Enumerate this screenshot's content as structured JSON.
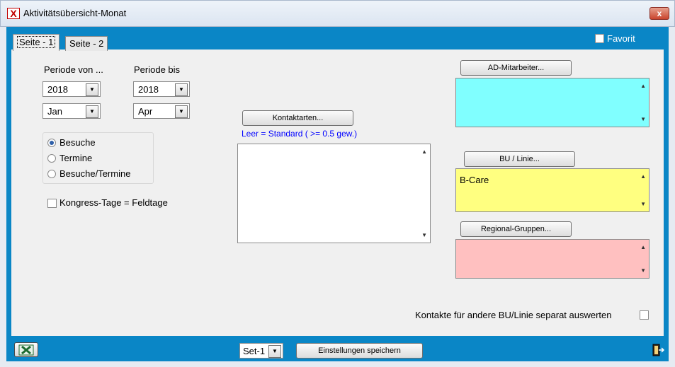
{
  "window": {
    "title": "Aktivitätsübersicht-Monat",
    "close_label": "x"
  },
  "tabs": [
    {
      "label": "Seite - 1"
    },
    {
      "label": "Seite - 2"
    }
  ],
  "favorite_label": "Favorit",
  "period": {
    "from_label": "Periode von ...",
    "to_label": "Periode bis",
    "from_year": "2018",
    "from_month": "Jan",
    "to_year": "2018",
    "to_month": "Apr"
  },
  "radio_options": [
    "Besuche",
    "Termine",
    "Besuche/Termine"
  ],
  "congress_label": "Kongress-Tage = Feldtage",
  "contact_types": {
    "button_label": "Kontaktarten...",
    "hint": "Leer = Standard  ( >= 0.5 gew.)"
  },
  "ad_staff": {
    "button_label": "AD-Mitarbeiter..."
  },
  "bu_line": {
    "button_label": "BU / Linie...",
    "items": [
      "B-Care"
    ]
  },
  "regional_groups": {
    "button_label": "Regional-Gruppen..."
  },
  "separate_label": "Kontakte für andere BU/Linie separat auswerten",
  "footer": {
    "set_value": "Set-1",
    "save_label": "Einstellungen speichern"
  },
  "colors": {
    "accent_blue": "#0a86c6",
    "ad_staff_bg": "#80ffff",
    "bu_bg": "#ffff80",
    "regional_bg": "#ffc0c0",
    "hint_blue": "#0000ff"
  },
  "icons": {
    "app": "excel-x-icon",
    "footer_left": "excel-icon",
    "footer_right": "exit-door-icon"
  }
}
